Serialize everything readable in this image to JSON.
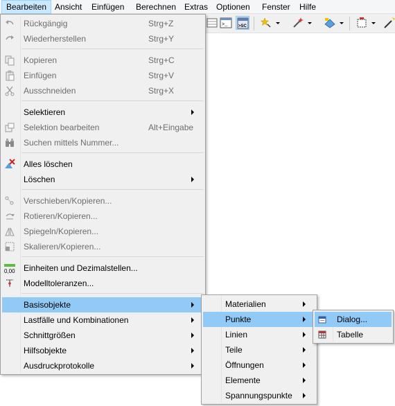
{
  "menubar": {
    "items": [
      {
        "label": "Bearbeiten"
      },
      {
        "label": "Ansicht"
      },
      {
        "label": "Einfügen"
      },
      {
        "label": "Berechnen"
      },
      {
        "label": "Extras"
      },
      {
        "label": "Optionen"
      },
      {
        "label": "Fenster"
      },
      {
        "label": "Hilfe"
      }
    ]
  },
  "toolbar": {
    "script_label": ">SC",
    "console_label": ">_"
  },
  "edit_menu": {
    "items": [
      {
        "label": "Rückgängig",
        "shortcut": "Strg+Z",
        "icon": "undo-icon"
      },
      {
        "label": "Wiederherstellen",
        "shortcut": "Strg+Y",
        "icon": "redo-icon"
      },
      {
        "label": "Kopieren",
        "shortcut": "Strg+C",
        "icon": "copy-icon"
      },
      {
        "label": "Einfügen",
        "shortcut": "Strg+V",
        "icon": "paste-icon"
      },
      {
        "label": "Ausschneiden",
        "shortcut": "Strg+X",
        "icon": "cut-icon"
      },
      {
        "label": "Selektieren"
      },
      {
        "label": "Selektion bearbeiten",
        "shortcut": "Alt+Eingabe",
        "icon": "edit-selection-icon"
      },
      {
        "label": "Suchen mittels Nummer...",
        "icon": "binoculars-icon"
      },
      {
        "label": "Alles löschen",
        "icon": "delete-all-icon"
      },
      {
        "label": "Löschen"
      },
      {
        "label": "Verschieben/Kopieren...",
        "icon": "move-icon"
      },
      {
        "label": "Rotieren/Kopieren...",
        "icon": "rotate-icon"
      },
      {
        "label": "Spiegeln/Kopieren...",
        "icon": "mirror-icon"
      },
      {
        "label": "Skalieren/Kopieren...",
        "icon": "scale-icon"
      },
      {
        "label": "Einheiten und Dezimalstellen...",
        "icon": "units-icon",
        "icon_text": "0,00"
      },
      {
        "label": "Modelltoleranzen...",
        "icon": "tolerance-icon"
      },
      {
        "label": "Basisobjekte"
      },
      {
        "label": "Lastfälle und Kombinationen"
      },
      {
        "label": "Schnittgrößen"
      },
      {
        "label": "Hilfsobjekte"
      },
      {
        "label": "Ausdruckprotokolle"
      }
    ]
  },
  "basis_menu": {
    "items": [
      {
        "label": "Materialien"
      },
      {
        "label": "Punkte"
      },
      {
        "label": "Linien"
      },
      {
        "label": "Teile"
      },
      {
        "label": "Öffnungen"
      },
      {
        "label": "Elemente"
      },
      {
        "label": "Spannungspunkte"
      }
    ]
  },
  "punkte_menu": {
    "items": [
      {
        "label": "Dialog...",
        "icon": "dialog-icon"
      },
      {
        "label": "Tabelle",
        "icon": "table-icon"
      }
    ]
  },
  "colors": {
    "highlight": "#91c9f7",
    "menu_bg": "#f0f0f0",
    "disabled_text": "#6d6d6d",
    "menubar_active": "#cce8ff"
  }
}
